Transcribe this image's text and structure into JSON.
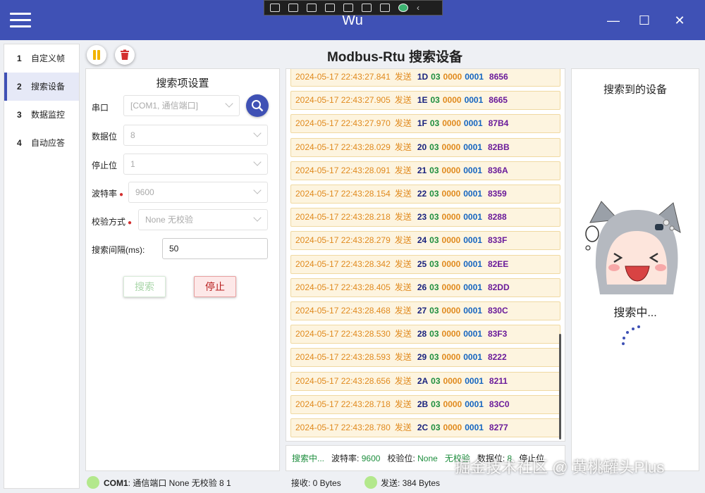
{
  "app": {
    "title": "Wu",
    "minimize": "—",
    "maximize": "☐",
    "close": "✕"
  },
  "colors": {
    "primary": "#3f51b5",
    "sent": "#e08a1e",
    "address": "#1a237e",
    "function": "#1e8e3e",
    "crc": "#6a1b9a",
    "led": "#b3e88c"
  },
  "nav": [
    {
      "num": "1",
      "label": "自定义帧"
    },
    {
      "num": "2",
      "label": "搜索设备"
    },
    {
      "num": "3",
      "label": "数据监控"
    },
    {
      "num": "4",
      "label": "自动应答"
    }
  ],
  "page_title": "Modbus-Rtu 搜索设备",
  "settings": {
    "title": "搜索项设置",
    "port_label": "串口",
    "port_value": "[COM1, 通信端口]",
    "databits_label": "数据位",
    "databits_value": "8",
    "stopbits_label": "停止位",
    "stopbits_value": "1",
    "baud_label": "波特率",
    "baud_value": "9600",
    "parity_label": "校验方式",
    "parity_value": "None   无校验",
    "interval_label": "搜索间隔(ms):",
    "interval_value": "50",
    "required_mark": "●",
    "search_button": "搜索",
    "stop_button": "停止"
  },
  "log": [
    {
      "ts": "2024-05-17 22:43:27.841",
      "dir": "发送",
      "addr": "1D",
      "fn": "03",
      "reg": "0000",
      "cnt": "0001",
      "crc": "8656"
    },
    {
      "ts": "2024-05-17 22:43:27.905",
      "dir": "发送",
      "addr": "1E",
      "fn": "03",
      "reg": "0000",
      "cnt": "0001",
      "crc": "8665"
    },
    {
      "ts": "2024-05-17 22:43:27.970",
      "dir": "发送",
      "addr": "1F",
      "fn": "03",
      "reg": "0000",
      "cnt": "0001",
      "crc": "87B4"
    },
    {
      "ts": "2024-05-17 22:43:28.029",
      "dir": "发送",
      "addr": "20",
      "fn": "03",
      "reg": "0000",
      "cnt": "0001",
      "crc": "82BB"
    },
    {
      "ts": "2024-05-17 22:43:28.091",
      "dir": "发送",
      "addr": "21",
      "fn": "03",
      "reg": "0000",
      "cnt": "0001",
      "crc": "836A"
    },
    {
      "ts": "2024-05-17 22:43:28.154",
      "dir": "发送",
      "addr": "22",
      "fn": "03",
      "reg": "0000",
      "cnt": "0001",
      "crc": "8359"
    },
    {
      "ts": "2024-05-17 22:43:28.218",
      "dir": "发送",
      "addr": "23",
      "fn": "03",
      "reg": "0000",
      "cnt": "0001",
      "crc": "8288"
    },
    {
      "ts": "2024-05-17 22:43:28.279",
      "dir": "发送",
      "addr": "24",
      "fn": "03",
      "reg": "0000",
      "cnt": "0001",
      "crc": "833F"
    },
    {
      "ts": "2024-05-17 22:43:28.342",
      "dir": "发送",
      "addr": "25",
      "fn": "03",
      "reg": "0000",
      "cnt": "0001",
      "crc": "82EE"
    },
    {
      "ts": "2024-05-17 22:43:28.405",
      "dir": "发送",
      "addr": "26",
      "fn": "03",
      "reg": "0000",
      "cnt": "0001",
      "crc": "82DD"
    },
    {
      "ts": "2024-05-17 22:43:28.468",
      "dir": "发送",
      "addr": "27",
      "fn": "03",
      "reg": "0000",
      "cnt": "0001",
      "crc": "830C"
    },
    {
      "ts": "2024-05-17 22:43:28.530",
      "dir": "发送",
      "addr": "28",
      "fn": "03",
      "reg": "0000",
      "cnt": "0001",
      "crc": "83F3"
    },
    {
      "ts": "2024-05-17 22:43:28.593",
      "dir": "发送",
      "addr": "29",
      "fn": "03",
      "reg": "0000",
      "cnt": "0001",
      "crc": "8222"
    },
    {
      "ts": "2024-05-17 22:43:28.656",
      "dir": "发送",
      "addr": "2A",
      "fn": "03",
      "reg": "0000",
      "cnt": "0001",
      "crc": "8211"
    },
    {
      "ts": "2024-05-17 22:43:28.718",
      "dir": "发送",
      "addr": "2B",
      "fn": "03",
      "reg": "0000",
      "cnt": "0001",
      "crc": "83C0"
    },
    {
      "ts": "2024-05-17 22:43:28.780",
      "dir": "发送",
      "addr": "2C",
      "fn": "03",
      "reg": "0000",
      "cnt": "0001",
      "crc": "8277"
    }
  ],
  "status": {
    "state": "搜索中...",
    "baud_label": "波特率:",
    "baud_value": "9600",
    "parity_label": "校验位:",
    "parity_value": "None",
    "parity_desc": "无校验",
    "databits_label": "数据位:",
    "databits_value": "8",
    "stopbits_label": "停止位"
  },
  "found": {
    "title": "搜索到的设备",
    "searching": "搜索中..."
  },
  "footer": {
    "port": "COM1",
    "port_info": ": 通信端口  None   无校验  8  1",
    "received": "接收: 0 Bytes",
    "sent": "发送: 384 Bytes"
  },
  "watermark": "掘金技术社区 @ 黄桃罐头Plus"
}
